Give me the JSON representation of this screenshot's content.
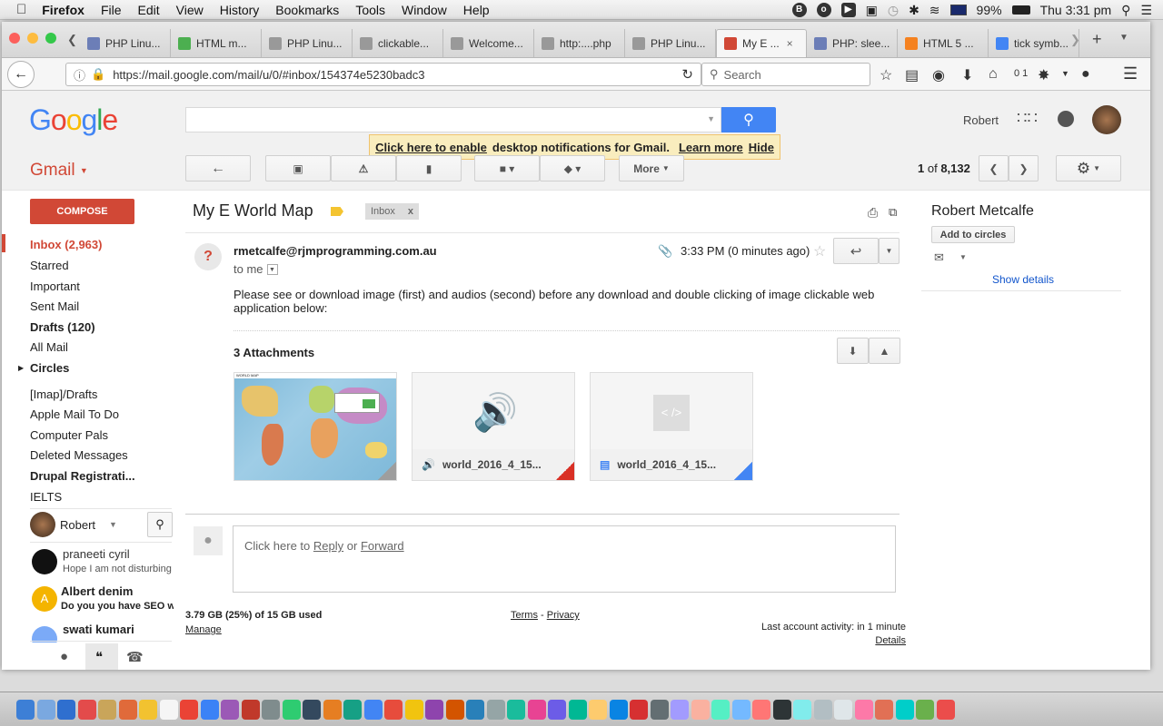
{
  "menubar": {
    "app_name": "Firefox",
    "items": [
      "File",
      "Edit",
      "View",
      "History",
      "Bookmarks",
      "Tools",
      "Window",
      "Help"
    ],
    "battery": "99%",
    "clock": "Thu 3:31 pm"
  },
  "browser": {
    "tabs": [
      {
        "label": "PHP Linu...",
        "icon": "php-icon",
        "color": "#6c7eb7"
      },
      {
        "label": "HTML m...",
        "icon": "w3-icon",
        "color": "#4caf50"
      },
      {
        "label": "PHP Linu...",
        "icon": "page-icon",
        "color": "#999999"
      },
      {
        "label": "clickable...",
        "icon": "page-icon",
        "color": "#999999"
      },
      {
        "label": "Welcome...",
        "icon": "page-icon",
        "color": "#999999"
      },
      {
        "label": "http:....php",
        "icon": "page-icon",
        "color": "#999999"
      },
      {
        "label": "PHP Linu...",
        "icon": "page-icon",
        "color": "#999999"
      },
      {
        "label": "My E ...",
        "icon": "gmail-icon",
        "color": "#d14836",
        "active": true
      },
      {
        "label": "PHP: slee...",
        "icon": "php-icon",
        "color": "#6c7eb7"
      },
      {
        "label": "HTML 5 ...",
        "icon": "q-icon",
        "color": "#f58220"
      },
      {
        "label": "tick symb...",
        "icon": "google-icon",
        "color": "#4285f4"
      }
    ],
    "url": "https://mail.google.com/mail/u/0/#inbox/154374e5230badc3",
    "search_placeholder": "Search",
    "counter": "0 1"
  },
  "gmail": {
    "logo_letters": [
      "G",
      "o",
      "o",
      "g",
      "l",
      "e"
    ],
    "logo_colors": [
      "#4285f4",
      "#ea4335",
      "#fbbc05",
      "#4285f4",
      "#34a853",
      "#ea4335"
    ],
    "account_name": "Robert",
    "notification": {
      "enable_link": "Click here to enable",
      "text": "desktop notifications for Gmail.",
      "learn_more": "Learn more",
      "hide": "Hide"
    },
    "gmail_label": "Gmail",
    "more_label": "More",
    "pagination": {
      "range": "1",
      "of": "of",
      "total": "8,132"
    },
    "compose_label": "COMPOSE",
    "nav_items": [
      {
        "label": "Inbox (2,963)",
        "bold": true,
        "red": true
      },
      {
        "label": "Starred"
      },
      {
        "label": "Important"
      },
      {
        "label": "Sent Mail"
      },
      {
        "label": "Drafts (120)",
        "bold": true
      },
      {
        "label": "All Mail"
      },
      {
        "label": "Circles",
        "bold": true
      },
      {
        "label": "[Imap]/Drafts"
      },
      {
        "label": "Apple Mail To Do"
      },
      {
        "label": "Computer Pals"
      },
      {
        "label": "Deleted Messages"
      },
      {
        "label": "Drupal Registrati...",
        "bold": true
      },
      {
        "label": "IELTS"
      }
    ],
    "chat": {
      "me": "Robert",
      "contacts": [
        {
          "name": "praneeti cyril",
          "snippet": "Hope I am not disturbing"
        },
        {
          "name": "Albert denim",
          "snippet": "Do you you have SEO w"
        },
        {
          "name": "swati kumari",
          "snippet": ""
        }
      ]
    },
    "email": {
      "subject": "My E World Map",
      "label_chip": "Inbox",
      "label_close": "x",
      "sender": "rmetcalfe@rjmprogramming.com.au",
      "to": "to me",
      "time": "3:33 PM (0 minutes ago)",
      "body": "Please see or download image (first) and audios (second) before any download and double clicking of image clickable web application below:",
      "attachments_title": "3 Attachments",
      "attachments": [
        {
          "name": "WORLD MAP",
          "type": "image"
        },
        {
          "name": "world_2016_4_15...",
          "type": "audio",
          "accent": "#d93025"
        },
        {
          "name": "world_2016_4_15...",
          "type": "document",
          "accent": "#4285f4"
        }
      ]
    },
    "reply": {
      "prefix": "Click here to",
      "reply": "Reply",
      "or": "or",
      "forward": "Forward"
    },
    "footer": {
      "storage": "3.79 GB (25%) of 15 GB used",
      "manage": "Manage",
      "terms": "Terms",
      "sep": "-",
      "privacy": "Privacy",
      "activity": "Last account activity: in 1 minute",
      "details": "Details"
    },
    "contact_panel": {
      "name": "Robert Metcalfe",
      "add_circles": "Add to circles",
      "show_details": "Show details"
    }
  }
}
